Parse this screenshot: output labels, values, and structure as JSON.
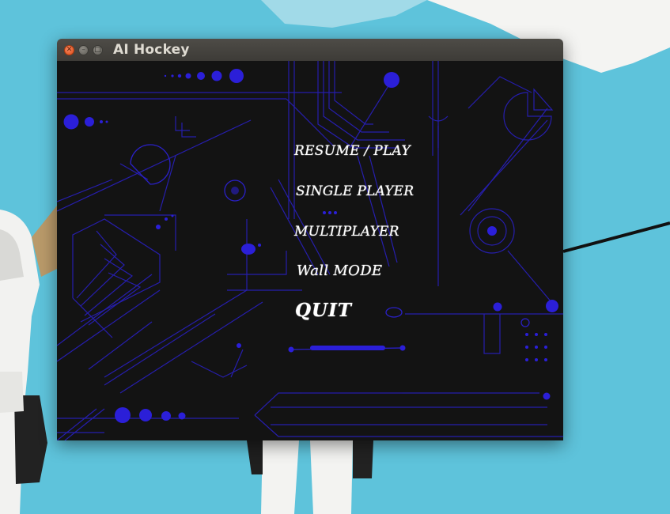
{
  "window": {
    "title": "AI Hockey",
    "controls": {
      "close_icon": "close-icon",
      "minimize_icon": "minimize-icon",
      "maximize_icon": "maximize-icon"
    }
  },
  "menu": {
    "items": [
      {
        "label": "RESUME / PLAY"
      },
      {
        "label": "SINGLE PLAYER"
      },
      {
        "label": "MULTIPLAYER"
      },
      {
        "label": "Wall MODE"
      },
      {
        "label": "QUIT"
      }
    ]
  },
  "colors": {
    "game_background": "#131313",
    "circuit_accent": "#2b1fd8",
    "menu_text": "#ffffff",
    "desktop_background": "#5ec3db"
  }
}
